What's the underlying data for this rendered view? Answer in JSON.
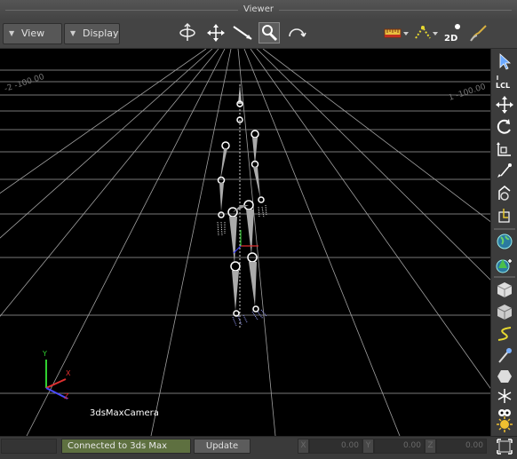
{
  "window": {
    "title": "Viewer"
  },
  "toolbar": {
    "view_label": "View",
    "display_label": "Display",
    "icons": [
      "orbit-icon",
      "pan-icon",
      "dolly-icon",
      "zoom-icon",
      "undo-view-icon",
      "ruler-icon",
      "path-icon",
      "2d-view-icon",
      "brush-icon"
    ],
    "twod_label": "2D"
  },
  "viewport": {
    "camera_label": "3dsMaxCamera",
    "axis_labels": {
      "x": "X",
      "y": "Y",
      "z": "Z"
    },
    "grid_label_left": "-2 -100.00",
    "grid_label_right": "1 -100.00",
    "colors": {
      "background": "#000000",
      "grid": "#a0a0a0",
      "skeleton": "#d8d8d8"
    }
  },
  "status": {
    "connection": "Connected to 3ds Max",
    "update_label": "Update",
    "x_label": "X",
    "x_value": "0.00",
    "y_label": "Y",
    "y_value": "0.00",
    "z_label": "Z",
    "z_value": "0.00",
    "connection_color": "#5e7040"
  },
  "sidebar": {
    "icons": [
      "select-icon",
      "local-axis-icon",
      "move-icon",
      "rotate-icon",
      "scale-icon",
      "snap-icon",
      "ik-icon",
      "pivot-icon",
      "globe-icon",
      "globe-tree-icon",
      "cube-solid-icon",
      "cube-icon",
      "curve-icon",
      "bone-icon",
      "hexagon-icon",
      "asterisk-icon",
      "eyes-icon",
      "light-icon",
      "frame-icon"
    ],
    "lcl_label": "LCL"
  }
}
